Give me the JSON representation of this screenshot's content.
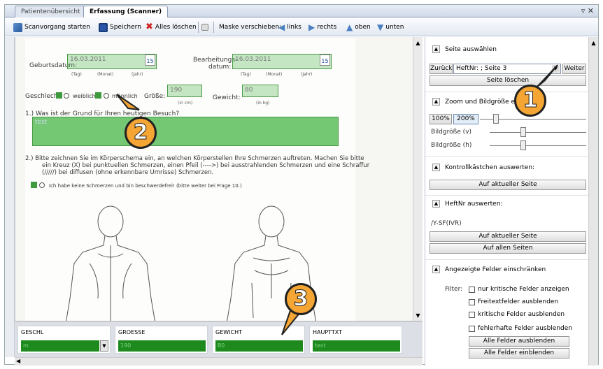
{
  "tabs": [
    {
      "label": "Patientenübersicht"
    },
    {
      "label": "Erfassung (Scanner)"
    }
  ],
  "tab_controls": "▿ ✕",
  "toolbar": {
    "scan": "Scanvorgang starten",
    "save": "Speichern",
    "clear": "Alles löschen",
    "move_label": "Maske verschieben:",
    "left": "links",
    "right": "rechts",
    "up": "oben",
    "down": "unten"
  },
  "form": {
    "geburtsdatum_label": "Geburtsdatum:",
    "geburtsdatum_value": "16.03.2011",
    "bearbeitung_label1": "Bearbeitungs-",
    "bearbeitung_label2": "datum:",
    "bearbeitung_value": "16.03.2011",
    "calendar_btn": "15",
    "tag": "(Tag)",
    "monat": "(Monat)",
    "jahr": "(Jahr)",
    "geschlecht": "Geschlecht:",
    "weiblich": "weiblich",
    "maennlich": "männlich",
    "groesse": "Größe:",
    "groesse_value": "190",
    "groesse_unit": "(in cm)",
    "gewicht": "Gewicht:",
    "gewicht_value": "80",
    "gewicht_unit": "(in kg)",
    "q1": "1.)   Was ist der Grund für Ihren heutigen Besuch?",
    "q1_value": "test",
    "q2a": "2.)   Bitte zeichnen Sie im Körperschema ein, an welchen Körperstellen Ihre Schmerzen auftreten. Machen Sie bitte",
    "q2b": "ein Kreuz (X) bei punktuellen Schmerzen, einen Pfeil (---->) bei ausstrahlenden Schmerzen und eine Schraffur",
    "q2c": "(/////) bei diffusen (ohne erkennbare Umrisse) Schmerzen.",
    "no_pain": "Ich habe keine Schmerzen und bin beschwerdefrei! (bitte weiter bei Frage 10.)"
  },
  "fields": [
    {
      "header": "GESCHL",
      "value": "m"
    },
    {
      "header": "GROESSE",
      "value": "190"
    },
    {
      "header": "GEWICHT",
      "value": "80"
    },
    {
      "header": "HAUPTTXT",
      "value": "test"
    }
  ],
  "panel": {
    "seite_title": "Seite auswählen",
    "zurueck": "Zurück",
    "page_combo": "HeftNr: ; Seite 3",
    "weiter": "Weiter",
    "seite_loeschen": "Seite löschen",
    "zoom_title": "Zoom und Bildgröße ein...",
    "zoom_100": "100%",
    "zoom_200": "200%",
    "bild_v": "Bildgröße (v)",
    "bild_h": "Bildgröße (h)",
    "kontroll_title": "Kontrollkästchen auswerten:",
    "auf_aktueller_seite": "Auf aktueller Seite",
    "heftnr_title": "HeftNr auswerten:",
    "heftnr_value": "/Y-SF(IVR)",
    "auf_aktueller_seite2": "Auf aktueller Seite",
    "auf_allen_seiten": "Auf allen Seiten",
    "felder_title": "Angezeigte Felder einschränken",
    "filter": "Filter:",
    "cb1": "nur kritische Felder anzeigen",
    "cb2": "Freitextfelder ausblenden",
    "cb3": "kritische Felder ausblenden",
    "cb4": "fehlerhafte Felder ausblenden",
    "alle_aus": "Alle Felder ausblenden",
    "alle_ein": "Alle Felder einblenden"
  },
  "callouts": [
    "1",
    "2",
    "3"
  ],
  "icons": [
    "scanner-icon",
    "save-icon",
    "delete-icon",
    "arrow-left-icon",
    "arrow-right-icon",
    "arrow-up-icon",
    "arrow-down-icon"
  ],
  "colors": {
    "accent": "#f4a533",
    "field_green": "#1e8a1e",
    "overlay_green": "#5ab45a"
  }
}
